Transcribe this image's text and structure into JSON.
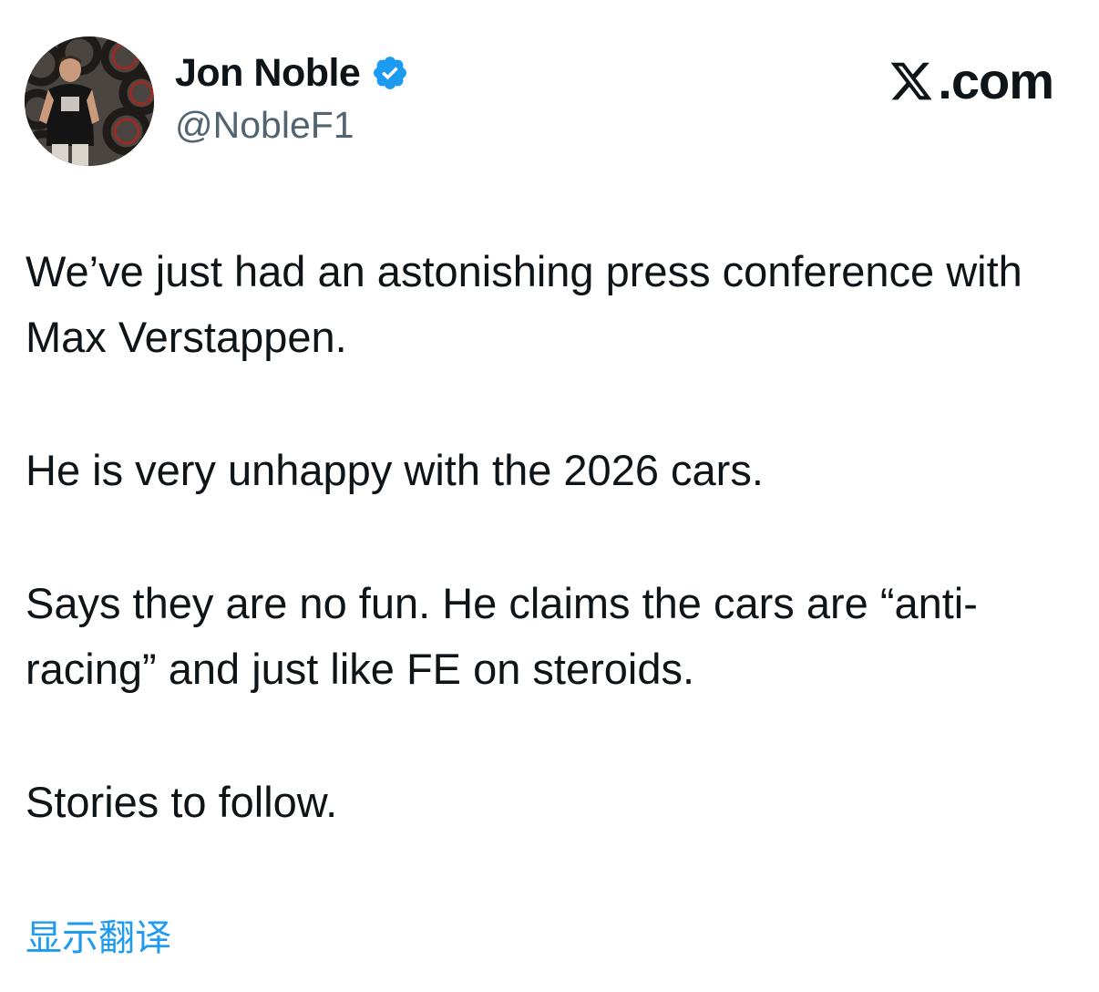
{
  "author": {
    "display_name": "Jon Noble",
    "handle": "@NobleF1",
    "verified": true,
    "avatar_icon": "profile-photo"
  },
  "brand": {
    "label": ".com",
    "logo_icon": "x-logo-icon"
  },
  "tweet": {
    "paragraphs": [
      "We’ve just had an astonishing press conference with Max Verstappen.",
      "He is very unhappy with the 2026 cars.",
      "Says they are no fun. He claims the cars are “anti-racing” and just like FE on steroids.",
      "Stories to follow."
    ]
  },
  "actions": {
    "translate_label": "显示翻译"
  },
  "colors": {
    "text": "#0f1419",
    "secondary": "#536471",
    "accent": "#1d9bf0"
  }
}
